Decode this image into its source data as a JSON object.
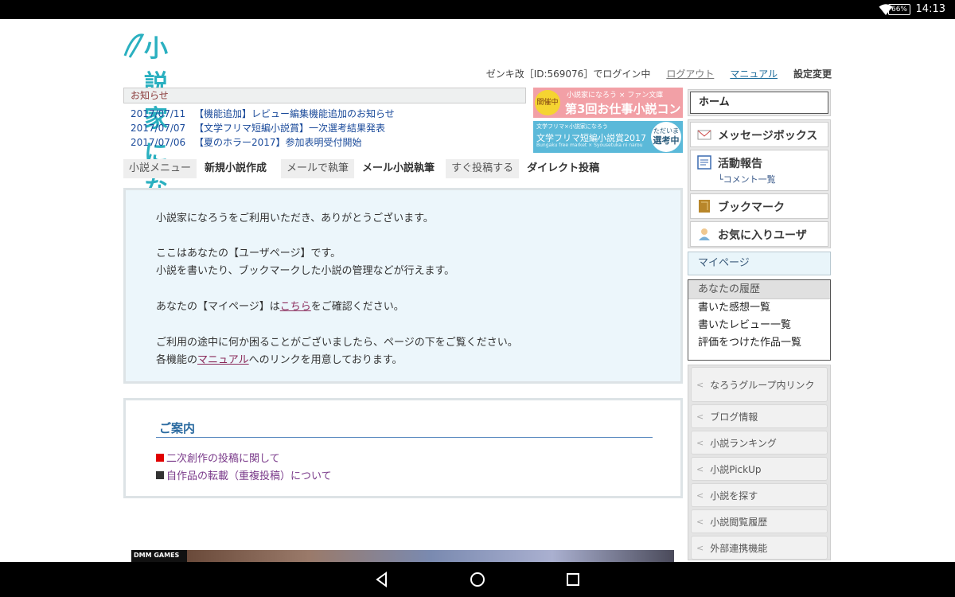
{
  "status_bar": {
    "battery": "66%",
    "time": "14:13"
  },
  "logo": {
    "text": "小説家になろう"
  },
  "login_bar": {
    "user": "ゼンキ改［ID:569076］でログイン中",
    "logout": "ログアウト",
    "manual": "マニュアル",
    "settings": "設定変更"
  },
  "notices": {
    "heading": "お知らせ",
    "items": [
      {
        "date": "2017/07/11",
        "title": "【機能追加】レビュー編集機能追加のお知らせ"
      },
      {
        "date": "2017/07/07",
        "title": "【文学フリマ短編小説賞】一次選考結果発表"
      },
      {
        "date": "2017/07/06",
        "title": "【夏のホラー2017】参加表明受付開始"
      }
    ]
  },
  "banners": {
    "contest": {
      "tag": "開催中",
      "top": "小説家になろう × ファン文庫",
      "main": "第3回お仕事小説コン"
    },
    "bunfuri": {
      "top": "文学フリマ×小説家になろう",
      "main": "文学フリマ短編小説賞2017",
      "sub": "Bungaku free market × Syousetuka ni narou",
      "badge_top": "ただいま",
      "badge_main": "選考中"
    }
  },
  "actions": [
    {
      "label": "小説メニュー",
      "action": "新規小説作成"
    },
    {
      "label": "メールで執筆",
      "action": "メール小説執筆"
    },
    {
      "label": "すぐ投稿する",
      "action": "ダイレクト投稿"
    }
  ],
  "welcome": {
    "line1": "小説家になろうをご利用いただき、ありがとうございます。",
    "line2": "ここはあなたの【ユーザページ】です。",
    "line3": "小説を書いたり、ブックマークした小説の管理などが行えます。",
    "line4_pre": "あなたの【マイページ】は",
    "line4_link": "こちら",
    "line4_post": "をご確認ください。",
    "line5": "ご利用の途中に何か困ることがございましたら、ページの下をご覧ください。",
    "line6_pre": "各機能の",
    "line6_link": "マニュアル",
    "line6_post": "へのリンクを用意しております。"
  },
  "guide": {
    "title": "ご案内",
    "items": [
      {
        "text": "二次創作の投稿に関して",
        "color": "#e00000"
      },
      {
        "text": "自作品の転載（重複投稿）について",
        "color": "#333333"
      }
    ]
  },
  "ad": {
    "label": "DMM GAMES"
  },
  "sidebar": {
    "home": "ホーム",
    "menu": [
      {
        "label": "メッセージボックス",
        "icon": "envelope-icon"
      },
      {
        "label": "活動報告",
        "sub": "└コメント一覧",
        "icon": "report-icon"
      },
      {
        "label": "ブックマーク",
        "icon": "bookmark-icon"
      },
      {
        "label": "お気に入りユーザ",
        "icon": "user-icon"
      }
    ],
    "mypage": "マイページ",
    "history": {
      "heading": "あなたの履歴",
      "items": [
        "書いた感想一覧",
        "書いたレビュー一覧",
        "評価をつけた作品一覧"
      ]
    },
    "links": [
      "なろうグループ内リンク",
      "ブログ情報",
      "小説ランキング",
      "小説PickUp",
      "小説を探す",
      "小説閲覧履歴",
      "外部連携機能"
    ]
  }
}
